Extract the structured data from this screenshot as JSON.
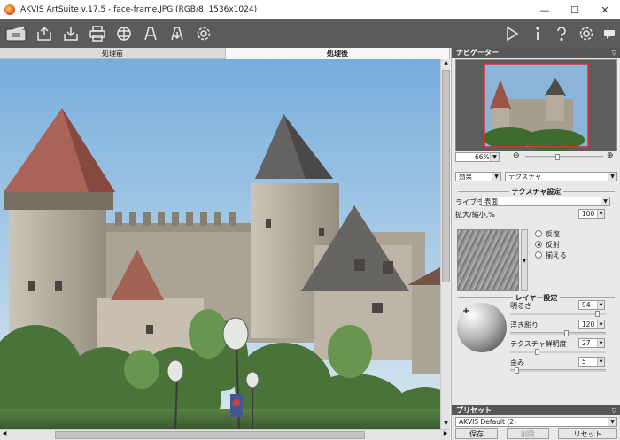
{
  "window": {
    "title": "AKVIS ArtSuite v.17.5 - face-frame.JPG (RGB/8, 1536x1024)",
    "minimize_glyph": "—",
    "maximize_glyph": "☐",
    "close_glyph": "✕"
  },
  "toolbar": {
    "left_icons": [
      "artsuite-logo-icon",
      "open-icon",
      "save-icon",
      "print-icon",
      "share-icon",
      "batch-icon",
      "export-icon",
      "settings-gear-icon"
    ],
    "right_icons": [
      "run-icon",
      "info-icon",
      "help-icon",
      "preferences-gear-icon",
      "chat-icon"
    ]
  },
  "tabs": {
    "before": "処理前",
    "after": "処理後",
    "active": "after"
  },
  "navigator": {
    "header": "ナビゲーター",
    "zoom_value": "66%",
    "zoom_out": "⊖",
    "zoom_in": "⊕"
  },
  "effect": {
    "label": "効果",
    "value": "テクスチャ"
  },
  "texture_settings": {
    "title": "テクスチャ設定",
    "library_label": "ライブラリ",
    "library_value": "表面",
    "scale_label": "拡大/縮小,%",
    "scale_value": "100",
    "modes": [
      "反復",
      "反射",
      "揃える"
    ],
    "selected_mode": "反射"
  },
  "layer_settings": {
    "title": "レイヤー設定",
    "brightness_label": "明るさ",
    "brightness_value": "94",
    "relief_label": "浮き彫り",
    "relief_value": "120",
    "clarity_label": "テクスチャ鮮明度",
    "clarity_value": "27",
    "distortion_label": "歪み",
    "distortion_value": "5"
  },
  "sliders": {
    "zoom": 0.42,
    "brightness": 0.94,
    "relief": 0.6,
    "clarity": 0.27,
    "distortion": 0.05
  },
  "presets": {
    "header": "プリセット",
    "value": "AKVIS Default (2)",
    "save_button": "保存",
    "delete_button": "削除",
    "reset_button": "リセット"
  }
}
